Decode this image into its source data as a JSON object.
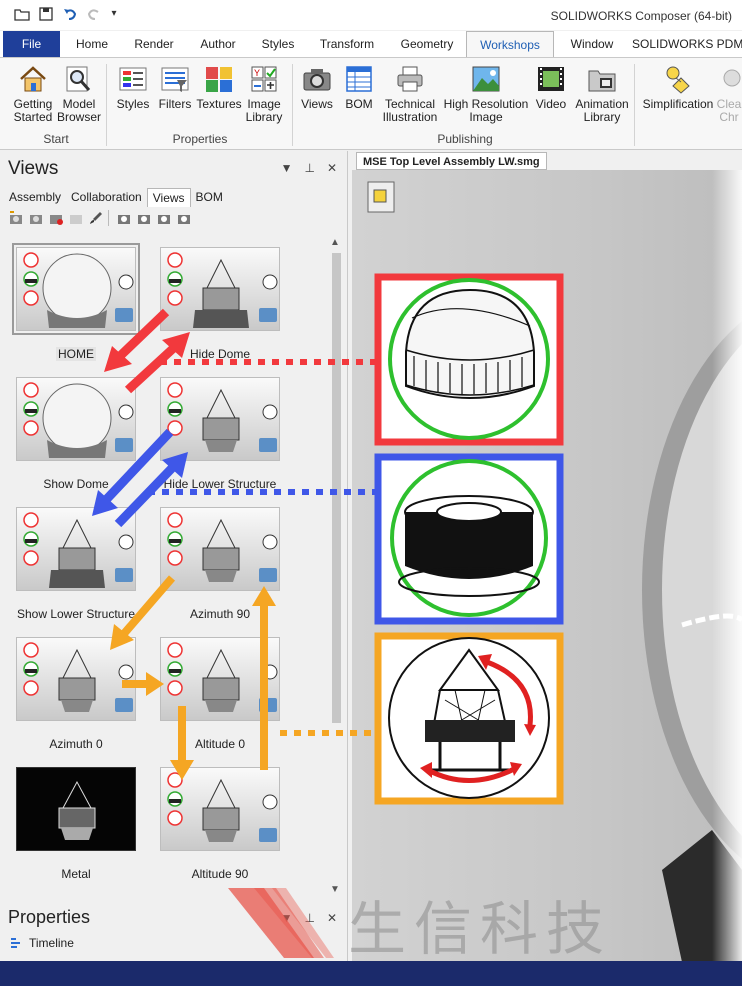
{
  "window": {
    "title": "SOLIDWORKS Composer (64-bit)"
  },
  "tabs": [
    "File",
    "Home",
    "Render",
    "Author",
    "Styles",
    "Transform",
    "Geometry",
    "Workshops",
    "Window",
    "SOLIDWORKS PDM"
  ],
  "ribbon": {
    "buttons": [
      {
        "label": "Getting\nStarted",
        "icon": "house-icon"
      },
      {
        "label": "Model\nBrowser",
        "icon": "magnifier-icon"
      },
      {
        "label": "Styles",
        "icon": "styles-icon"
      },
      {
        "label": "Filters",
        "icon": "filters-icon"
      },
      {
        "label": "Textures",
        "icon": "textures-icon"
      },
      {
        "label": "Image\nLibrary",
        "icon": "image-library-icon"
      },
      {
        "label": "Views",
        "icon": "camera-icon"
      },
      {
        "label": "BOM",
        "icon": "bom-icon"
      },
      {
        "label": "Technical\nIllustration",
        "icon": "printer-icon"
      },
      {
        "label": "High Resolution\nImage",
        "icon": "landscape-icon"
      },
      {
        "label": "Video",
        "icon": "film-icon"
      },
      {
        "label": "Animation\nLibrary",
        "icon": "folder-film-icon"
      },
      {
        "label": "Simplification",
        "icon": "simplification-icon"
      },
      {
        "label": "Clea\nChr",
        "icon": "clean-icon"
      }
    ],
    "groups": [
      "Start",
      "Properties",
      "Publishing"
    ]
  },
  "views_panel": {
    "title": "Views",
    "subtabs": [
      "Assembly",
      "Collaboration",
      "Views",
      "BOM"
    ],
    "active_subtab": "Views",
    "thumbnails": [
      {
        "label": "HOME",
        "selected": true
      },
      {
        "label": "Hide Dome"
      },
      {
        "label": "Show Dome"
      },
      {
        "label": "Hide Lower Structure"
      },
      {
        "label": "Show Lower Structure"
      },
      {
        "label": "Azimuth 90"
      },
      {
        "label": "Azimuth 0"
      },
      {
        "label": "Altitude 0"
      },
      {
        "label": "Metal"
      },
      {
        "label": "Altitude 90"
      }
    ]
  },
  "properties_panel": {
    "title": "Properties",
    "timeline_label": "Timeline"
  },
  "document_tab": "MSE Top Level Assembly LW.smg",
  "colors": {
    "red": "#f2393d",
    "blue": "#3f57e8",
    "orange": "#f5a623",
    "file_tab": "#1f3f9a",
    "green_ring": "#2ec02e"
  },
  "watermark": {
    "text": "生信科技"
  }
}
